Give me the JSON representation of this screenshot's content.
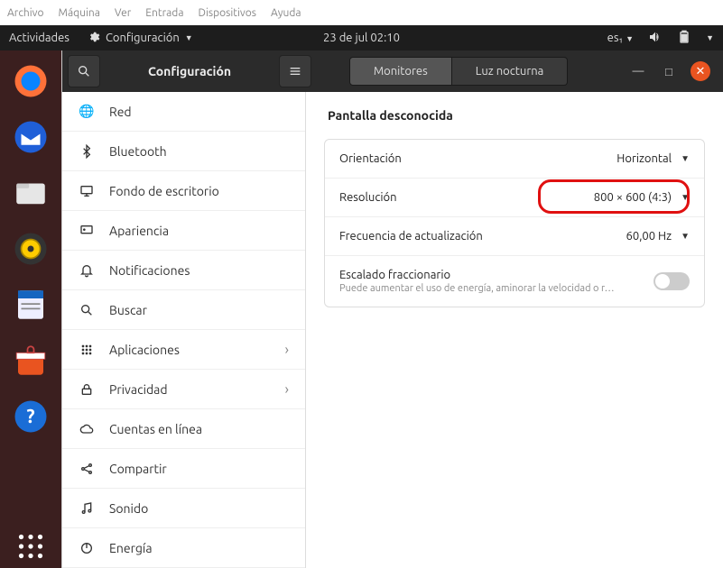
{
  "host_menu": [
    "Archivo",
    "Máquina",
    "Ver",
    "Entrada",
    "Dispositivos",
    "Ayuda"
  ],
  "topbar": {
    "activities": "Actividades",
    "app_name": "Configuración",
    "datetime": "23 de jul  02:10",
    "keyboard": "es₁"
  },
  "window": {
    "title": "Configuración",
    "tabs": {
      "monitors": "Monitores",
      "night": "Luz nocturna"
    }
  },
  "sidebar": {
    "items": [
      {
        "label": "Red"
      },
      {
        "label": "Bluetooth"
      },
      {
        "label": "Fondo de escritorio"
      },
      {
        "label": "Apariencia"
      },
      {
        "label": "Notificaciones"
      },
      {
        "label": "Buscar"
      },
      {
        "label": "Aplicaciones",
        "chevron": true
      },
      {
        "label": "Privacidad",
        "chevron": true
      },
      {
        "label": "Cuentas en línea"
      },
      {
        "label": "Compartir"
      },
      {
        "label": "Sonido"
      },
      {
        "label": "Energía"
      }
    ]
  },
  "content": {
    "section_title": "Pantalla desconocida",
    "rows": {
      "orientation": {
        "label": "Orientación",
        "value": "Horizontal"
      },
      "resolution": {
        "label": "Resolución",
        "value": "800 × 600 (4:3)"
      },
      "refresh": {
        "label": "Frecuencia de actualización",
        "value": "60,00 Hz"
      },
      "scaling": {
        "label": "Escalado fraccionario",
        "sub": "Puede aumentar el uso de energía, aminorar la velocidad o r…"
      }
    }
  }
}
